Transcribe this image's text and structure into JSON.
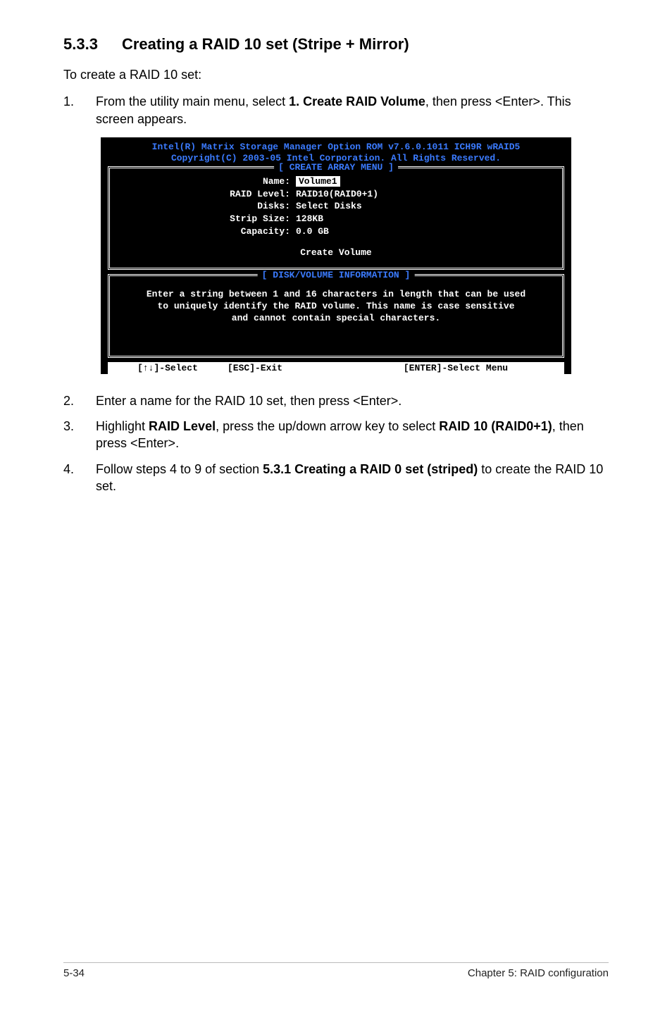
{
  "section": {
    "number": "5.3.3",
    "title": "Creating a RAID 10 set (Stripe + Mirror)"
  },
  "intro": "To create a RAID 10 set:",
  "steps": [
    {
      "num": "1.",
      "text_parts": [
        "From the utility main menu, select ",
        "1. Create RAID Volume",
        ", then press <Enter>. This screen appears."
      ]
    },
    {
      "num": "2.",
      "text_parts": [
        "Enter a name for the RAID 10 set, then press <Enter>."
      ]
    },
    {
      "num": "3.",
      "text_parts": [
        "Highlight ",
        "RAID Level",
        ", press the up/down arrow key to select ",
        "RAID 10 (RAID0+1)",
        ", then press <Enter>."
      ]
    },
    {
      "num": "4.",
      "text_parts": [
        "Follow steps 4 to 9 of section ",
        "5.3.1 Creating a RAID 0 set (striped)",
        " to create the RAID 10 set."
      ]
    }
  ],
  "bios": {
    "header_line1": "Intel(R) Matrix Storage Manager Option ROM v7.6.0.1011 ICH9R wRAID5",
    "header_line2": "Copyright(C) 2003-05 Intel Corporation. All Rights Reserved.",
    "menu_title": "[ CREATE ARRAY MENU ]",
    "fields": {
      "name_label": "Name:",
      "name_value": "Volume1",
      "raid_level_label": "RAID Level:",
      "raid_level_value": "RAID10(RAID0+1)",
      "disks_label": "Disks:",
      "disks_value": "Select Disks",
      "strip_size_label": "Strip Size:",
      "strip_size_value": "128KB",
      "capacity_label": "Capacity:",
      "capacity_value": "0.0   GB"
    },
    "create_volume": "Create Volume",
    "info_title": "[ DISK/VOLUME INFORMATION ]",
    "info_line1": "Enter a string between 1 and 16 characters in length that can be used",
    "info_line2": "to uniquely identify the RAID volume. This name is case sensitive",
    "info_line3": "and cannot contain special characters.",
    "footer_select": "[↑↓]-Select",
    "footer_exit": "[ESC]-Exit",
    "footer_enter": "[ENTER]-Select Menu"
  },
  "footer": {
    "left": "5-34",
    "right": "Chapter 5: RAID configuration"
  }
}
